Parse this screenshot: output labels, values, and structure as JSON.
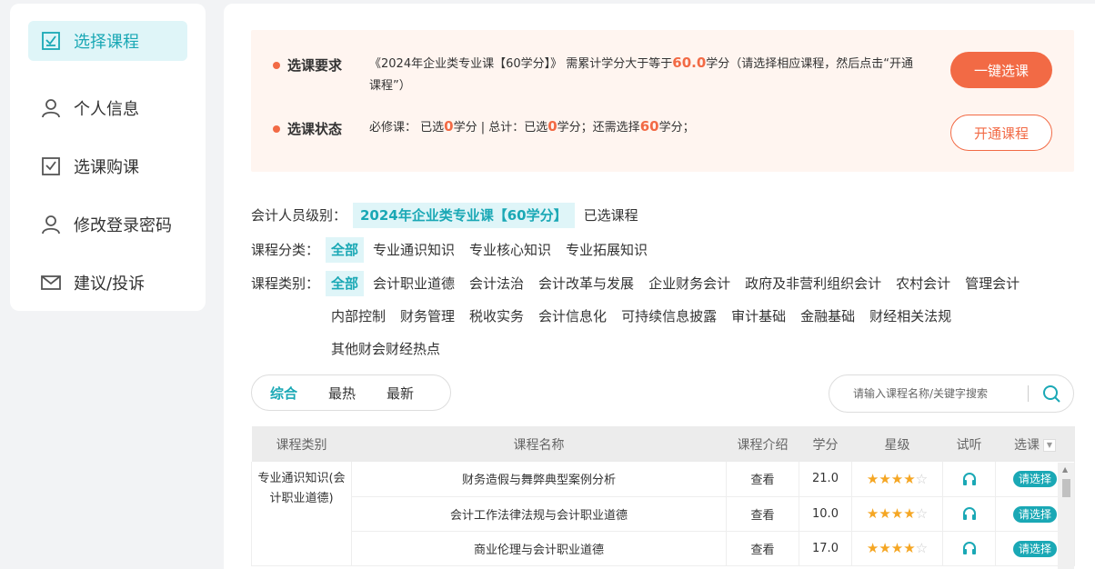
{
  "sidebar": {
    "items": [
      {
        "label": "选择课程",
        "icon": "checkbox-icon",
        "active": true
      },
      {
        "label": "个人信息",
        "icon": "user-icon"
      },
      {
        "label": "选课购课",
        "icon": "checkbox-icon"
      },
      {
        "label": "修改登录密码",
        "icon": "user-icon"
      },
      {
        "label": "建议/投诉",
        "icon": "mail-icon"
      }
    ]
  },
  "requirements": {
    "req_label": "选课要求",
    "req_text_pre": "《2024年企业类专业课【60学分】》 需累计学分大于等于",
    "req_credit": "60.0",
    "req_text_post": "学分（请选择相应课程，然后点击“开通课程”）",
    "status_label": "选课状态",
    "status_p1": "必修课：  已选",
    "status_n1": "0",
    "status_p2": "学分 | 总计：已选",
    "status_n2": "0",
    "status_p3": "学分；还需选择",
    "status_n3": "60",
    "status_p4": "学分；",
    "one_click_label": "一键选课",
    "open_label": "开通课程"
  },
  "filters": {
    "level_label": "会计人员级别：",
    "level_value": "2024年企业类专业课【60学分】",
    "selected_courses_label": "已选课程",
    "category_label": "课程分类：",
    "categories": [
      "全部",
      "专业通识知识",
      "专业核心知识",
      "专业拓展知识"
    ],
    "type_label": "课程类别：",
    "types": [
      "全部",
      "会计职业道德",
      "会计法治",
      "会计改革与发展",
      "企业财务会计",
      "政府及非营利组织会计",
      "农村会计",
      "管理会计",
      "内部控制",
      "财务管理",
      "税收实务",
      "会计信息化",
      "可持续信息披露",
      "审计基础",
      "金融基础",
      "财经相关法规",
      "其他财会财经热点"
    ]
  },
  "sorts": [
    "综合",
    "最热",
    "最新"
  ],
  "search": {
    "placeholder": "请输入课程名称/关键字搜索"
  },
  "table": {
    "headers": [
      "课程类别",
      "课程名称",
      "课程介绍",
      "学分",
      "星级",
      "试听",
      "选课"
    ],
    "category_cell": "专业通识知识(会计职业道德)",
    "rows": [
      {
        "name": "财务造假与舞弊典型案例分析",
        "intro": "查看",
        "credit": "21.0",
        "stars": 4,
        "pick": "请选择"
      },
      {
        "name": "会计工作法律法规与会计职业道德",
        "intro": "查看",
        "credit": "10.0",
        "stars": 4,
        "pick": "请选择"
      },
      {
        "name": "商业伦理与会计职业道德",
        "intro": "查看",
        "credit": "17.0",
        "stars": 4,
        "pick": "请选择"
      }
    ]
  },
  "colors": {
    "accent": "#1aa8b5",
    "orange": "#f26a45"
  }
}
